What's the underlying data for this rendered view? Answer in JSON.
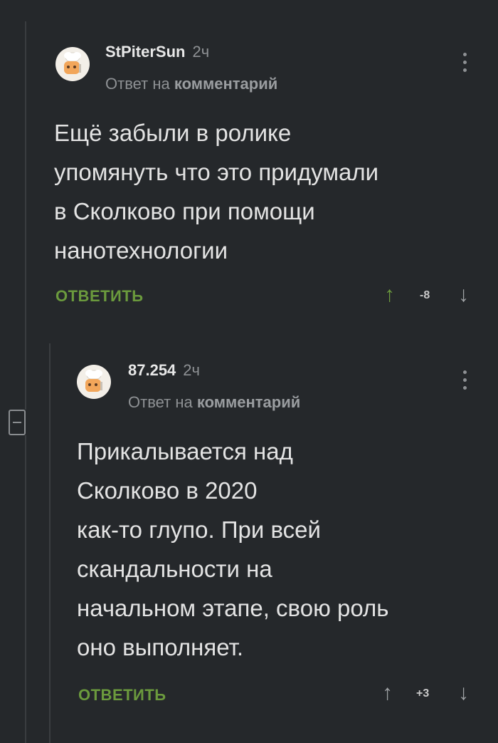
{
  "comments": [
    {
      "author": "StPiterSun",
      "time": "2ч",
      "reply_prefix": "Ответ на",
      "reply_target": "комментарий",
      "text": "Ещё забыли в ролике\nупомянуть что это придумали\nв Сколково при помощи\nнанотехнологии",
      "reply_label": "ОТВЕТИТЬ",
      "rating": "-8",
      "up_icon": "arrow-up-icon",
      "down_icon": "arrow-down-icon"
    },
    {
      "author": "87.254",
      "time": "2ч",
      "reply_prefix": "Ответ на",
      "reply_target": "комментарий",
      "text": "Прикалывается над\nСколково в 2020\nкак-то глупо. При всей\nскандальности на\nначальном этапе, свою роль\nоно выполняет.",
      "reply_label": "ОТВЕТИТЬ",
      "rating": "+3",
      "up_icon": "arrow-up-icon",
      "down_icon": "arrow-down-icon"
    }
  ],
  "colors": {
    "background": "#25282b",
    "accent": "#6b9a3d",
    "muted": "#8e9194"
  }
}
